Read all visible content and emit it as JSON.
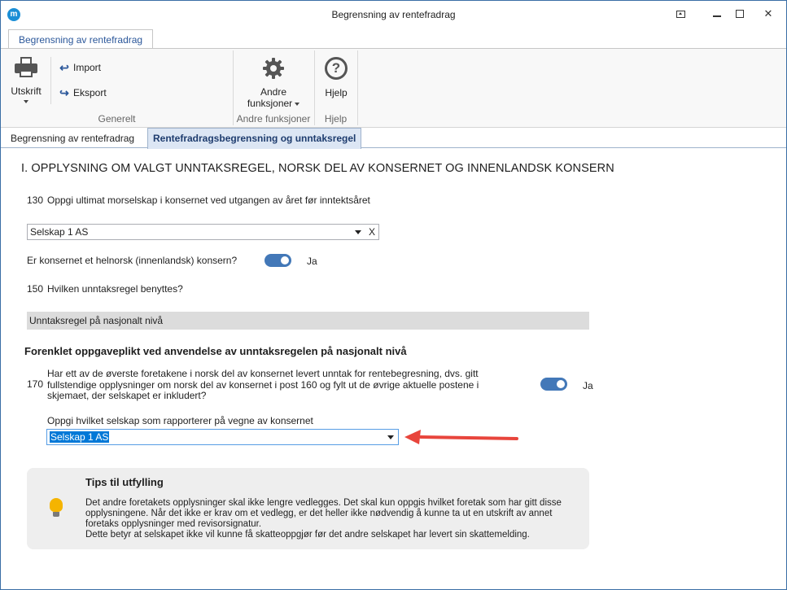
{
  "window": {
    "title": "Begrensning av rentefradrag",
    "logo_letter": "m"
  },
  "ribbon": {
    "tab": "Begrensning av rentefradrag",
    "print_label": "Utskrift",
    "import_label": "Import",
    "export_label": "Eksport",
    "group_general": "Generelt",
    "other_functions_line1": "Andre",
    "other_functions_line2": "funksjoner",
    "group_other": "Andre funksjoner",
    "help_label": "Hjelp",
    "group_help": "Hjelp"
  },
  "doc_tabs": [
    {
      "label": "Begrensning av rentefradrag",
      "active": false
    },
    {
      "label": "Rentefradragsbegrensning og unntaksregel",
      "active": true
    }
  ],
  "section": {
    "heading": "I. OPPLYSNING OM VALGT UNNTAKSREGEL, NORSK DEL AV KONSERNET OG INNENLANDSK KONSERN",
    "q130_nr": "130",
    "q130_label": "Oppgi ultimat morselskap i konsernet ved utgangen av året før inntektsåret",
    "q130_value": "Selskap 1 AS",
    "q130_clear": "X",
    "norsk_label": "Er konsernet et helnorsk (innenlandsk) konsern?",
    "norsk_value": "Ja",
    "q150_nr": "150",
    "q150_label": "Hvilken unntaksregel benyttes?",
    "q150_value": "Unntaksregel på nasjonalt nivå",
    "sub_heading": "Forenklet oppgaveplikt ved anvendelse av unntaksregelen på nasjonalt nivå",
    "q170_nr": "170",
    "q170_label": "Har ett av de øverste foretakene i norsk del av konsernet levert unntak for rentebegresning, dvs. gitt fullstendige opplysninger om norsk del av konsernet i post 160 og fylt ut de øvrige aktuelle postene i skjemaet, der selskapet er inkludert?",
    "q170_value": "Ja",
    "reporting_label": "Oppgi hvilket selskap som rapporterer på vegne av konsernet",
    "reporting_value": "Selskap 1 AS"
  },
  "tips": {
    "title": "Tips til utfylling",
    "line1": "Det andre foretakets opplysninger skal ikke lengre vedlegges. Det skal kun oppgis hvilket foretak som har gitt disse",
    "line2": "opplysningene. Når det ikke er krav om et vedlegg, er det heller ikke nødvendig å kunne ta ut en utskrift av annet",
    "line3": "foretaks opplysninger med revisorsignatur.",
    "line4": "Dette betyr at selskapet ikke vil kunne få skatteoppgjør før det andre selskapet har levert sin skattemelding.",
    "icon": "lightbulb-icon"
  },
  "colors": {
    "accent": "#4378b8",
    "selection": "#0078d7",
    "annotation_arrow": "#e8453c"
  }
}
